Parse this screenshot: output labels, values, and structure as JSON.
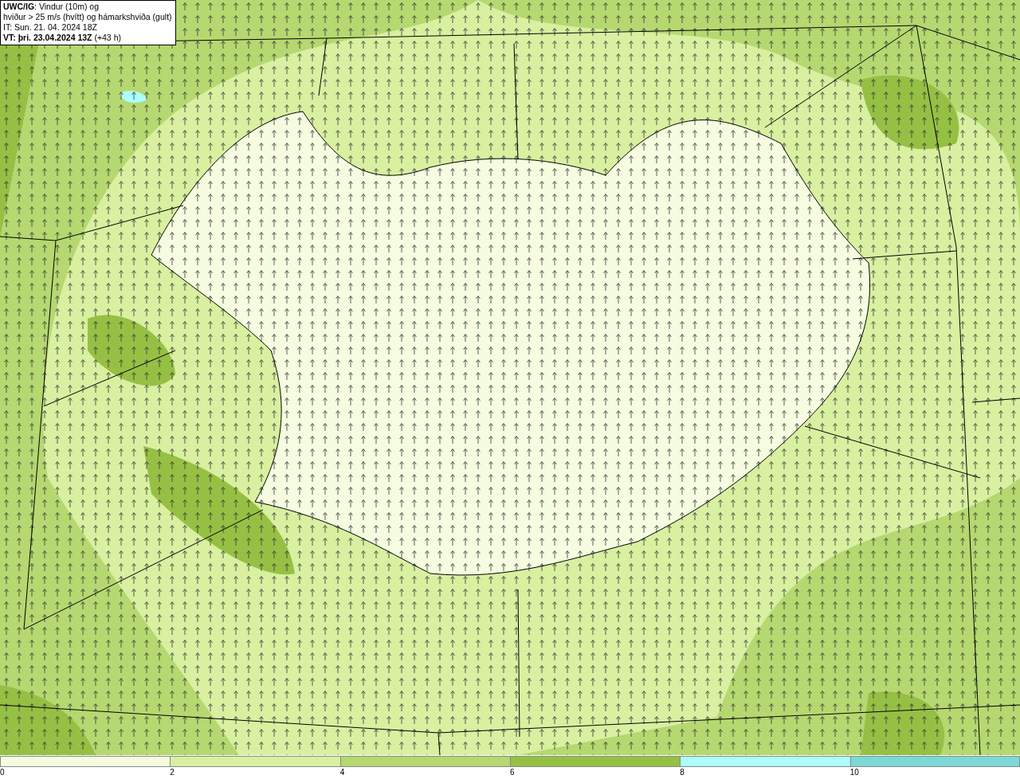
{
  "title_box": {
    "lines": [
      "**UWC/IG**: Vindur (10m) og",
      "hviður > 25 m/s (hvítt) og hámarkshviða (gult)",
      "IT: Sun. 21. 04. 2024 18Z",
      "**VT: þri. 23.04.2024 13Z** (+43 h)"
    ]
  },
  "legend": {
    "bins": [
      {
        "label": "0",
        "color": "#f5fce0"
      },
      {
        "label": "2",
        "color": "#d8f0a0"
      },
      {
        "label": "4",
        "color": "#b5d870"
      },
      {
        "label": "6",
        "color": "#96c044"
      },
      {
        "label": "8",
        "color": "#adfefe"
      },
      {
        "label": "10",
        "color": "#7dd8d8"
      }
    ]
  }
}
